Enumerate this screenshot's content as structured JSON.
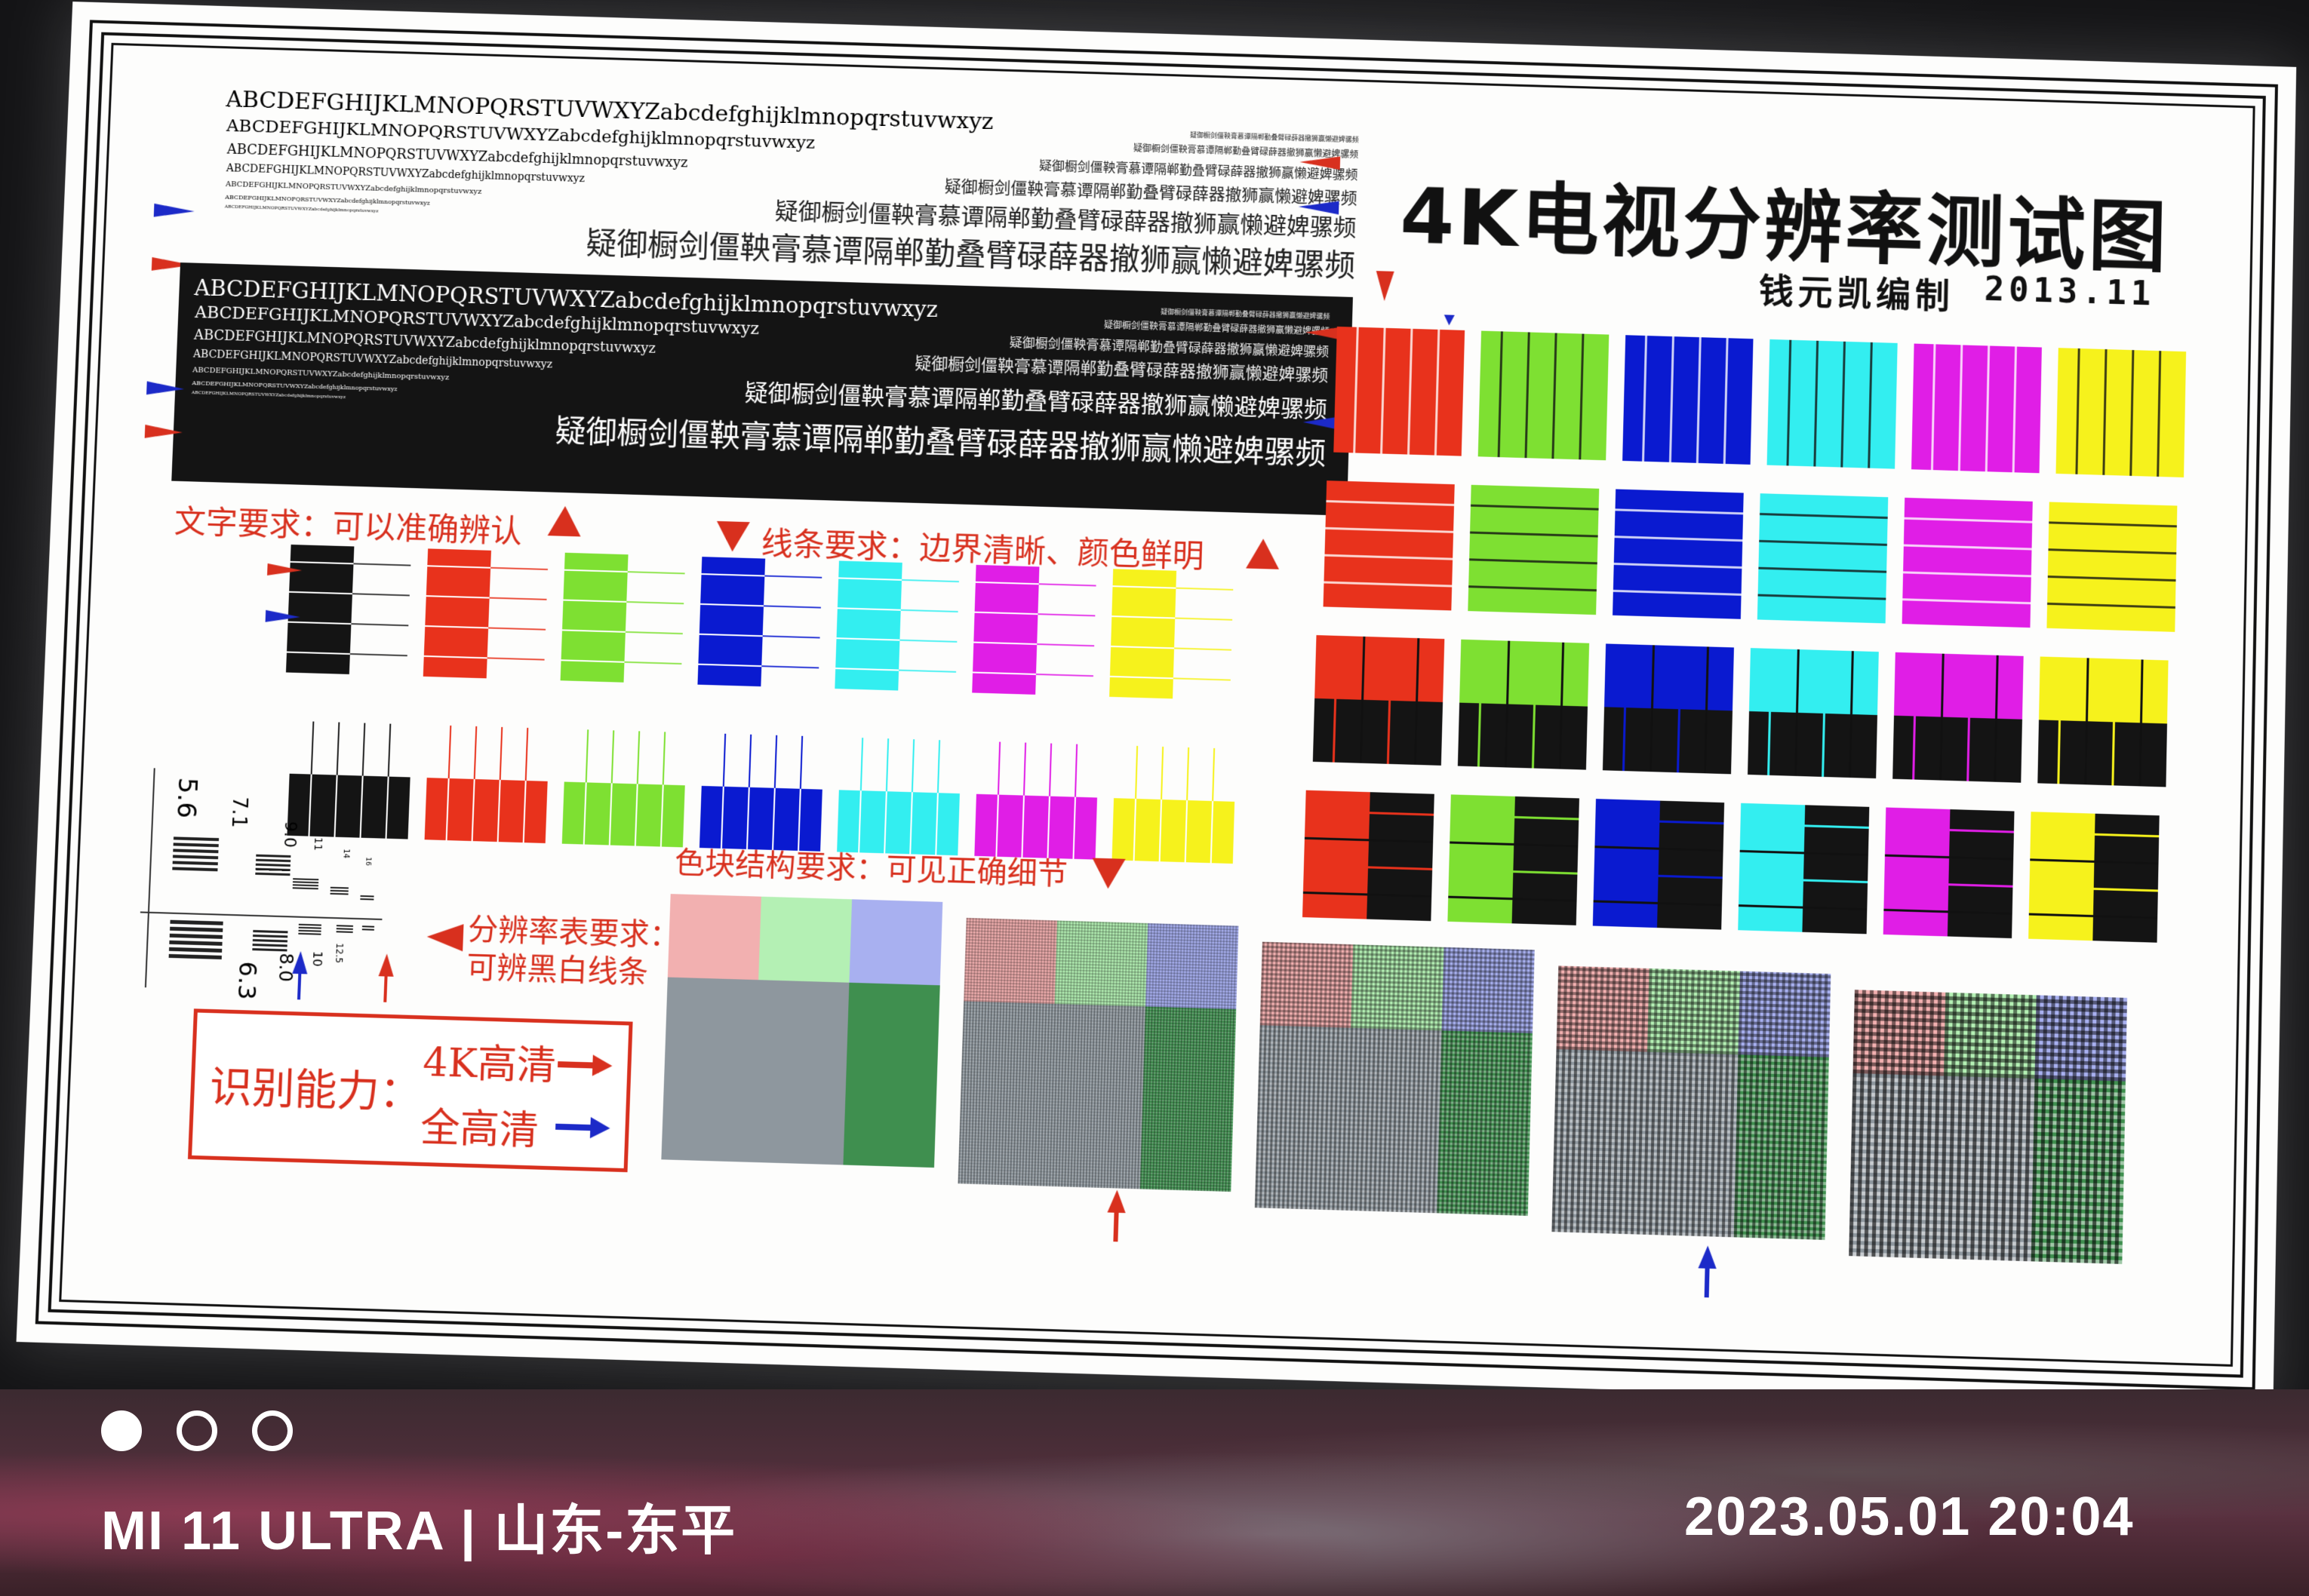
{
  "test_chart": {
    "title": "4K电视分辨率测试图",
    "author": "钱元凯编制",
    "date": "2013.11",
    "alphabet_lines": [
      "ABCDEFGHIJKLMNOPQRSTUVWXYZabcdefghijklmnopqrstuvwxyz",
      "ABCDEFGHIJKLMNOPQRSTUVWXYZabcdefghijklmnopqrstuvwxyz",
      "ABCDEFGHIJKLMNOPQRSTUVWXYZabcdefghijklmnopqrstuvwxyz",
      "ABCDEFGHIJKLMNOPQRSTUVWXYZabcdefghijklmnopqrstuvwxyz",
      "ABCDEFGHIJKLMNOPQRSTUVWXYZabcdefghijklmnopqrstuvwxyz",
      "ABCDEFGHIJKLMNOPQRSTUVWXYZabcdefghijklmnopqrstuvwxyz",
      "ABCDEFGHIJKLMNOPQRSTUVWXYZabcdefghijklmnopqrstuvwxyz"
    ],
    "chinese_lines": [
      "疑御橱剑僵鞅膏慕谭隔郸勤叠臂碌薛器撤狮赢懒避婢骡频",
      "疑御橱剑僵鞅膏慕谭隔郸勤叠臂碌薛器撤狮赢懒避婢骡频",
      "疑御橱剑僵鞅膏慕谭隔郸勤叠臂碌薛器撤狮赢懒避婢骡频",
      "疑御橱剑僵鞅膏慕谭隔郸勤叠臂碌薛器撤狮赢懒避婢骡频",
      "疑御橱剑僵鞅膏慕谭隔郸勤叠臂碌薛器撤狮赢懒避婢骡频",
      "疑御橱剑僵鞅膏慕谭隔郸勤叠臂碌薛器撤狮赢懒避婢骡频"
    ],
    "text_requirement": "文字要求：可以准确辨认",
    "line_requirement": "线条要求：边界清晰、颜色鲜明",
    "resolution_requirement_1": "分辨率表要求：",
    "resolution_requirement_2": "可辨黑白线条",
    "color_block_requirement": "色块结构要求：可见正确细节",
    "recognition_label": "识别能力：",
    "recognition_4k": "4K高清",
    "recognition_fullhd": "全高清",
    "resolution_numbers": [
      "5.6",
      "7.1",
      "9.0",
      "6.3",
      "8.0",
      "10",
      "12.5",
      "11",
      "14",
      "16"
    ],
    "colors": {
      "red": "#e8321c",
      "green": "#7ee032",
      "blue": "#0a1ad0",
      "cyan": "#33eef0",
      "magenta": "#e01ee6",
      "yellow": "#f6f21c",
      "black": "#141414",
      "accent_red": "#d8301e",
      "accent_blue": "#1c2ac8"
    }
  },
  "watermark": {
    "device": "MI 11 ULTRA | 山东-东平",
    "datetime": "2023.05.01  20:04",
    "dots": [
      "filled",
      "outline",
      "outline"
    ]
  }
}
